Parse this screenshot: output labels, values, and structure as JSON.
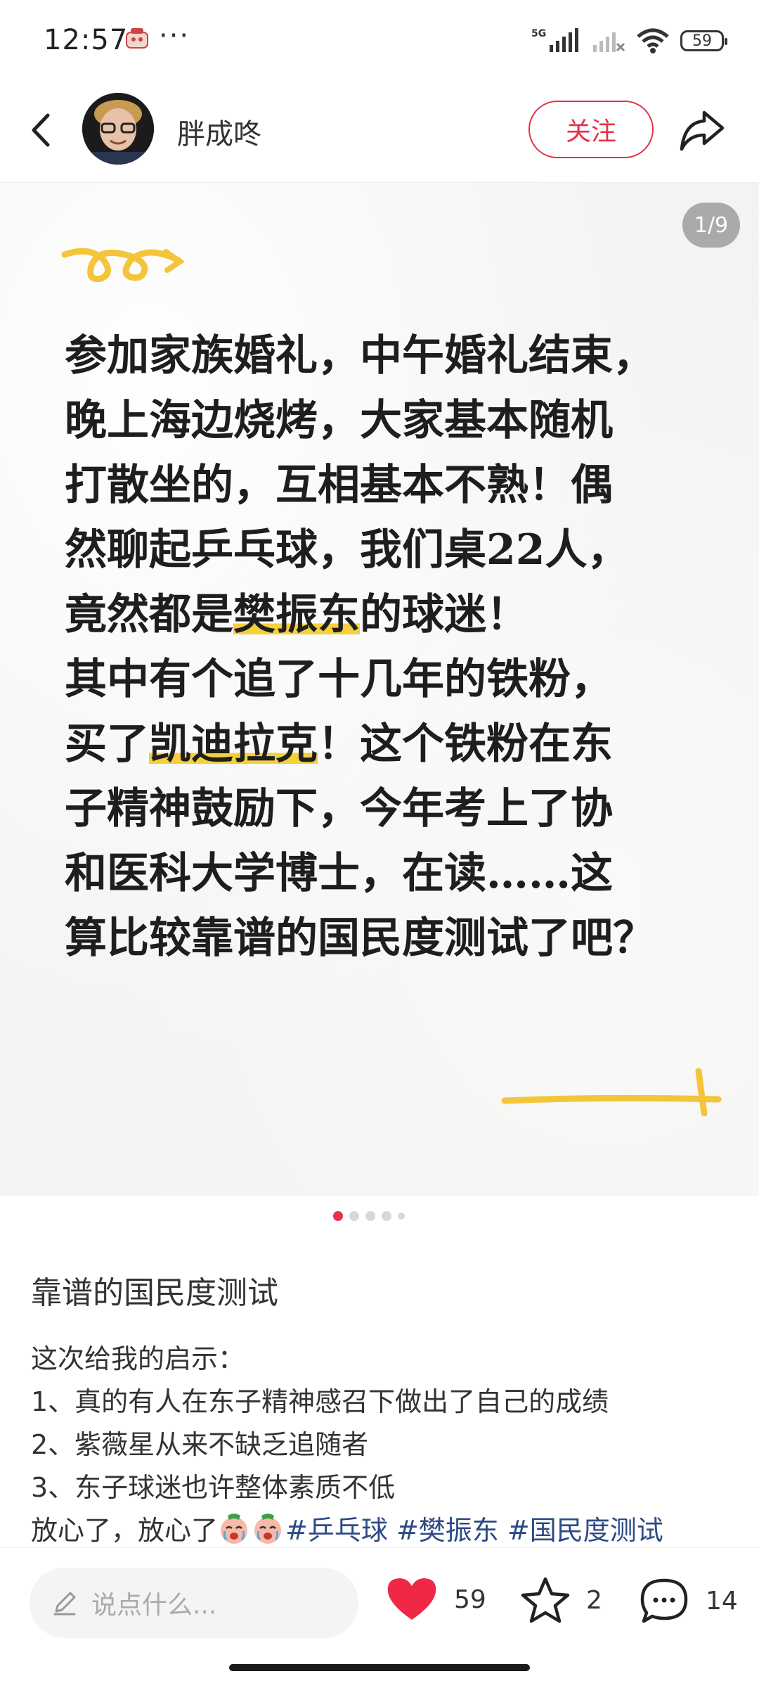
{
  "status_bar": {
    "time": "12:57",
    "more": "···",
    "network": "5G",
    "battery": "59"
  },
  "header": {
    "username": "胖成咚",
    "follow_label": "关注"
  },
  "image": {
    "pager": "1/9",
    "lines": [
      [
        {
          "t": "参加家族婚礼，中午婚礼结束，"
        }
      ],
      [
        {
          "t": "晚上海边烧烤，大家基本随机"
        }
      ],
      [
        {
          "t": "打散坐的，互相基本不熟！偶"
        }
      ],
      [
        {
          "t": "然聊起乒乓球，我们桌22人，"
        }
      ],
      [
        {
          "t": "竟然都是"
        },
        {
          "t": "樊振东",
          "hl": true
        },
        {
          "t": "的球迷！"
        }
      ],
      [
        {
          "t": "其中有个追了十几年的铁粉，"
        }
      ],
      [
        {
          "t": "买了"
        },
        {
          "t": "凯迪拉克",
          "hl": true
        },
        {
          "t": "！这个铁粉在东"
        }
      ],
      [
        {
          "t": "子精神鼓励下，今年考上了协"
        }
      ],
      [
        {
          "t": "和医科大学博士，在读……这"
        }
      ],
      [
        {
          "t": "算比较靠谱的国民度测试了吧？"
        }
      ]
    ],
    "highlight_color": "#f6cf3d"
  },
  "caption": {
    "title": "靠谱的国民度测试",
    "line1": "这次给我的启示：",
    "line2": "1、真的有人在东子精神感召下做出了自己的成绩",
    "line3": "2、紫薇星从来不缺乏追随者",
    "line4": "3、东子球迷也许整体素质不低",
    "line5_text": "放心了，放心了",
    "tag1": "#乒乓球",
    "tag2": "#樊振东",
    "tag3": "#国民度测试"
  },
  "bottom_bar": {
    "comment_placeholder": "说点什么...",
    "likes": "59",
    "favorites": "2",
    "comments": "14"
  },
  "colors": {
    "accent": "#e5334a",
    "tag": "#2c4a86"
  }
}
